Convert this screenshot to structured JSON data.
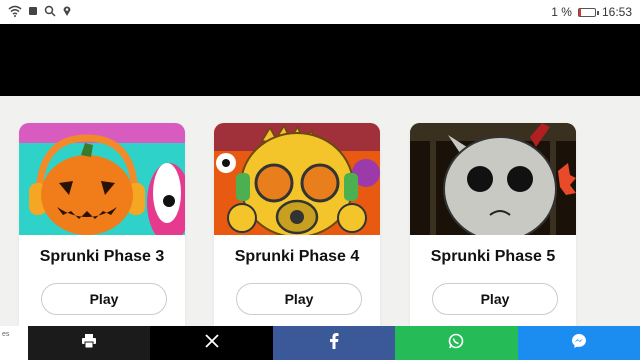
{
  "status": {
    "battery_text": "1 %",
    "time": "16:53",
    "battery_color": "#dd3333"
  },
  "cards": [
    {
      "title": "Sprunki Phase 3",
      "play_label": "Play",
      "image_icon": "pumpkin-character"
    },
    {
      "title": "Sprunki Phase 4",
      "play_label": "Play",
      "image_icon": "gasmask-character"
    },
    {
      "title": "Sprunki Phase 5",
      "play_label": "Play",
      "image_icon": "grey-character"
    }
  ],
  "share_bar": {
    "left_label": "es",
    "buttons": [
      {
        "name": "print",
        "icon": "printer-icon",
        "color": "#1b1b1b"
      },
      {
        "name": "x",
        "icon": "x-icon",
        "color": "#000000"
      },
      {
        "name": "facebook",
        "icon": "facebook-icon",
        "color": "#3b5998"
      },
      {
        "name": "whatsapp",
        "icon": "whatsapp-icon",
        "color": "#25bb56"
      },
      {
        "name": "messenger",
        "icon": "messenger-icon",
        "color": "#1b8cf0"
      }
    ]
  }
}
